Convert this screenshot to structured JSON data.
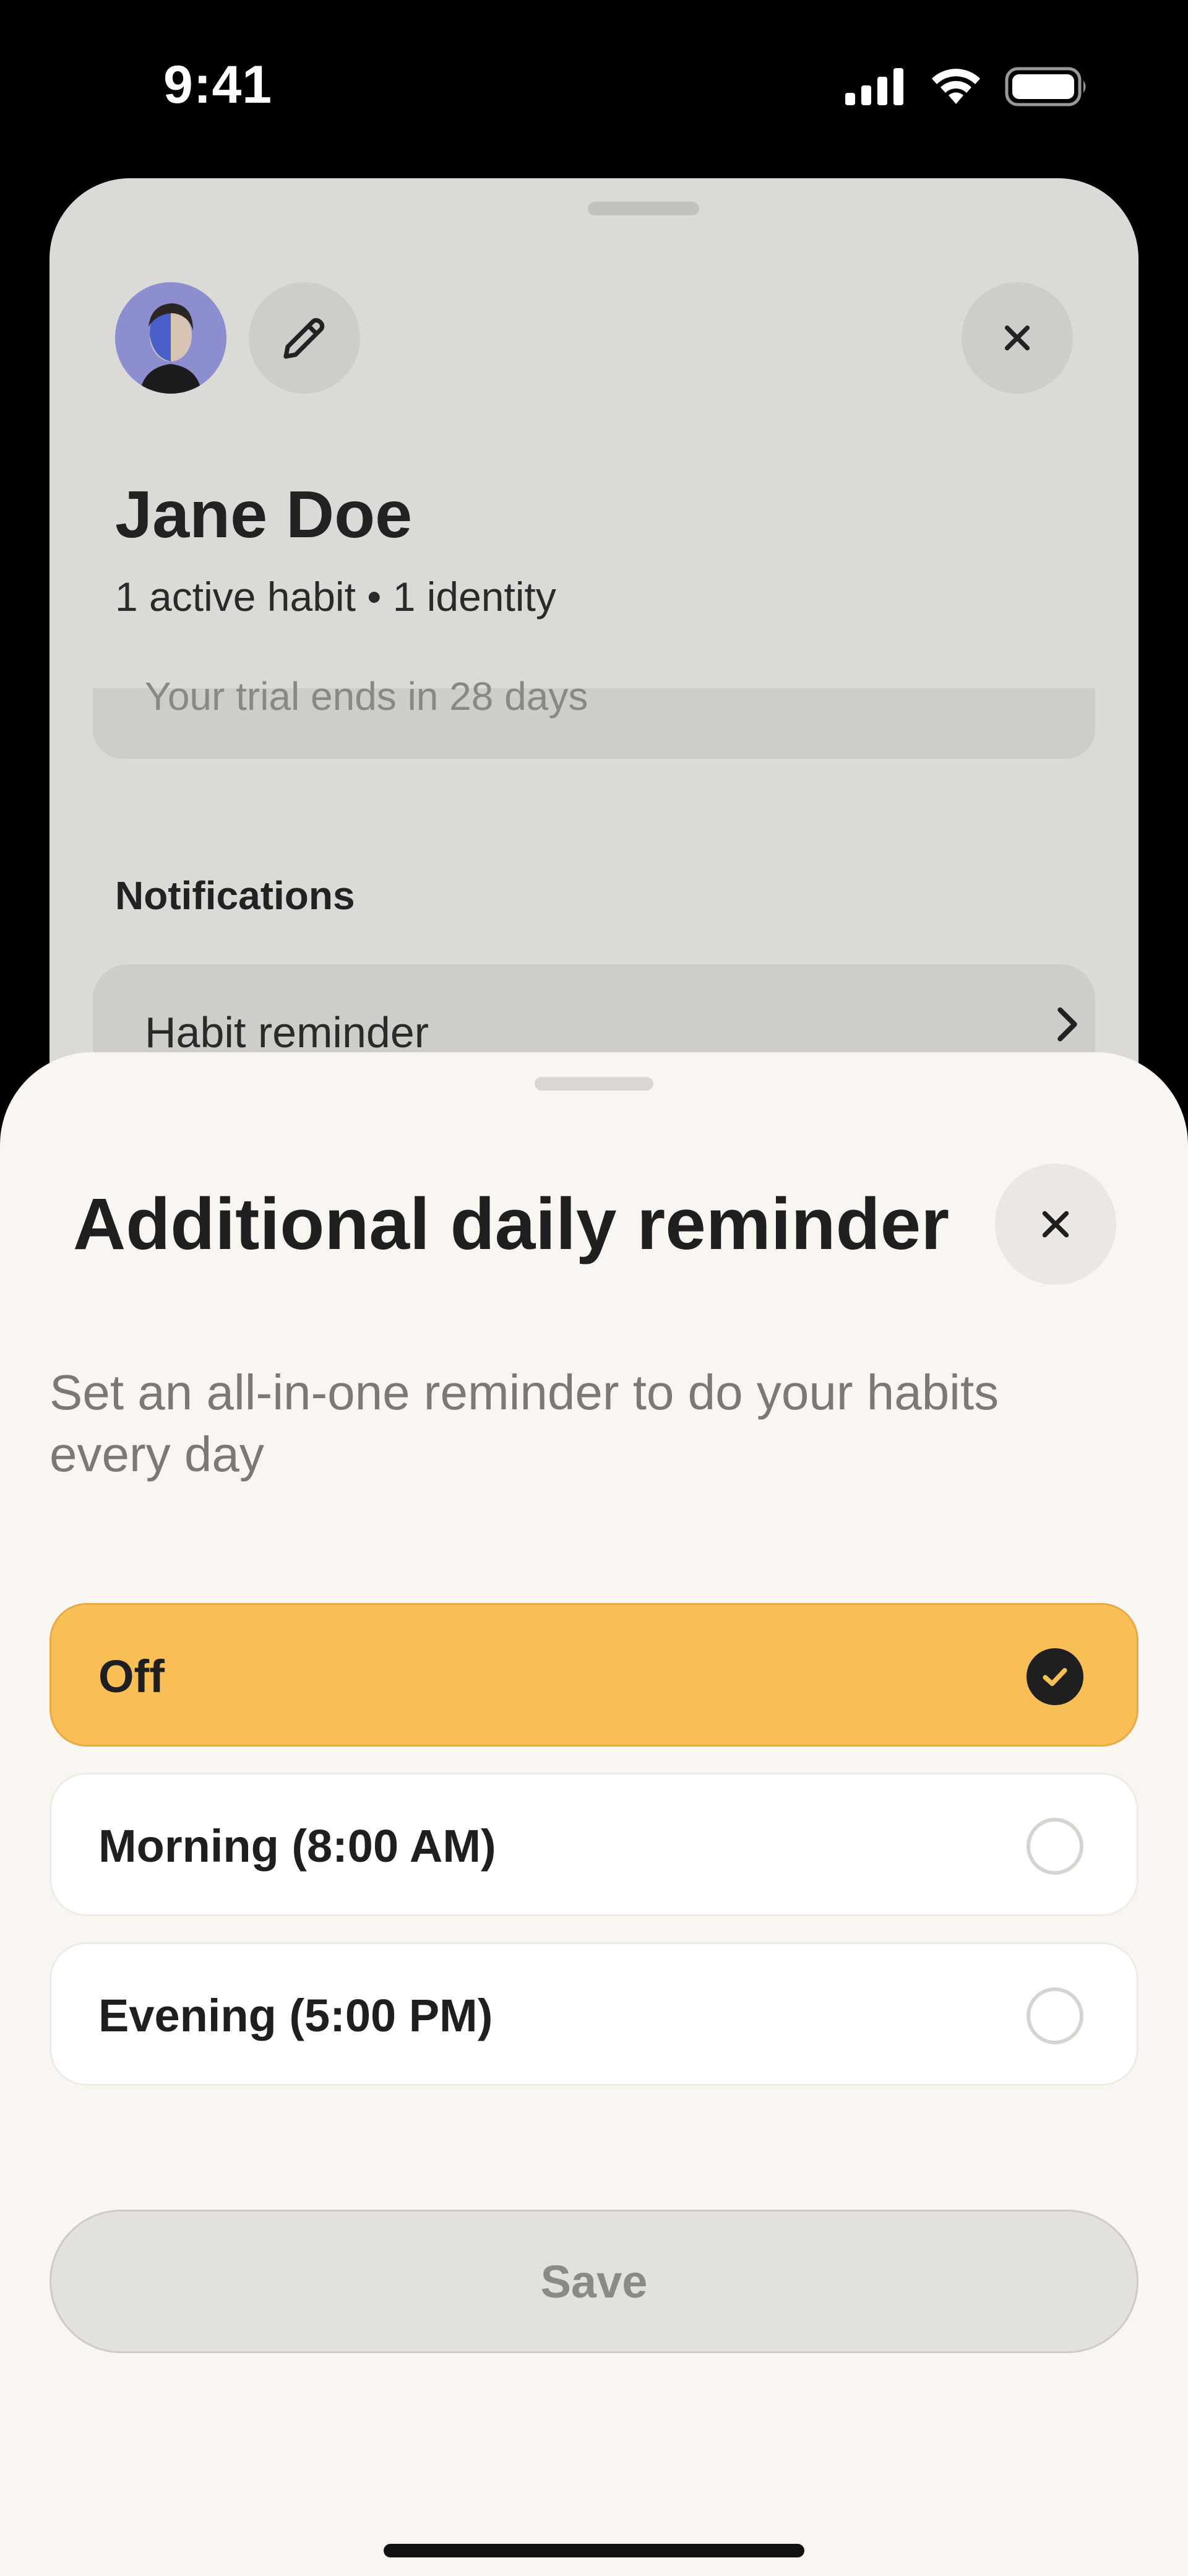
{
  "status_bar": {
    "time": "9:41"
  },
  "profile": {
    "name": "Jane Doe",
    "subtitle": "1 active habit • 1 identity",
    "trial_text": "Your trial ends in 28 days",
    "notifications_heading": "Notifications",
    "habit_reminder_label": "Habit reminder"
  },
  "reminder_sheet": {
    "title": "Additional daily reminder",
    "description": "Set an all-in-one reminder to do your habits every day",
    "options": [
      {
        "label": "Off",
        "selected": true
      },
      {
        "label": "Morning (8:00 AM)",
        "selected": false
      },
      {
        "label": "Evening (5:00 PM)",
        "selected": false
      }
    ],
    "save_label": "Save"
  },
  "colors": {
    "accent": "#f8bf57",
    "sheet_bg": "#f9f6f2",
    "background_sheet": "#dcdad6"
  },
  "icons": {
    "status": [
      "cellular-signal-icon",
      "wifi-icon",
      "battery-icon"
    ],
    "profile": [
      "avatar",
      "pencil-icon",
      "close-icon",
      "chevron-right-icon"
    ],
    "sheet": [
      "close-icon",
      "checkmark-icon"
    ]
  }
}
